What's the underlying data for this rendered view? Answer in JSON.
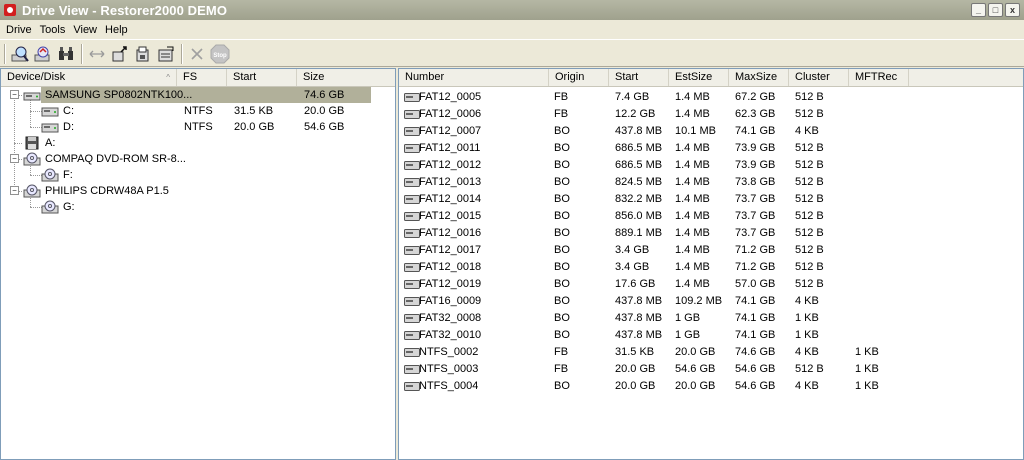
{
  "window": {
    "title": "Drive View - Restorer2000 DEMO",
    "controls": [
      "_",
      "□",
      "x"
    ]
  },
  "menu": [
    "Drive",
    "Tools",
    "View",
    "Help"
  ],
  "toolbar": {
    "buttons": [
      "search-disk-icon",
      "scan-disk-icon",
      "find-files-icon",
      "link-icon",
      "open-region-icon",
      "save-region-icon",
      "export-region-icon",
      "delete-icon",
      "stop-icon"
    ],
    "stop_label": "Stop"
  },
  "left": {
    "columns": [
      "Device/Disk",
      "FS",
      "Start",
      "Size"
    ],
    "tree": [
      {
        "label": "SAMSUNG SP0802NTK100...",
        "fs": "",
        "start": "",
        "size": "74.6 GB",
        "level": 0,
        "selected": true
      },
      {
        "label": "C:",
        "fs": "NTFS",
        "start": "31.5 KB",
        "size": "20.0 GB",
        "level": 1
      },
      {
        "label": "D:",
        "fs": "NTFS",
        "start": "20.0 GB",
        "size": "54.6 GB",
        "level": 1
      },
      {
        "label": "A:",
        "fs": "",
        "start": "",
        "size": "",
        "level": 0
      },
      {
        "label": "COMPAQ DVD-ROM SR-8...",
        "fs": "",
        "start": "",
        "size": "",
        "level": 0
      },
      {
        "label": "F:",
        "fs": "",
        "start": "",
        "size": "",
        "level": 1
      },
      {
        "label": "PHILIPS CDRW48A P1.5",
        "fs": "",
        "start": "",
        "size": "",
        "level": 0
      },
      {
        "label": "G:",
        "fs": "",
        "start": "",
        "size": "",
        "level": 1
      }
    ]
  },
  "right": {
    "columns": [
      "Number",
      "Origin",
      "Start",
      "EstSize",
      "MaxSize",
      "Cluster",
      "MFTRec"
    ],
    "rows": [
      [
        "FAT12_0005",
        "FB",
        "7.4 GB",
        "1.4 MB",
        "67.2 GB",
        "512 B",
        ""
      ],
      [
        "FAT12_0006",
        "FB",
        "12.2 GB",
        "1.4 MB",
        "62.3 GB",
        "512 B",
        ""
      ],
      [
        "FAT12_0007",
        "BO",
        "437.8 MB",
        "10.1 MB",
        "74.1 GB",
        "4 KB",
        ""
      ],
      [
        "FAT12_0011",
        "BO",
        "686.5 MB",
        "1.4 MB",
        "73.9 GB",
        "512 B",
        ""
      ],
      [
        "FAT12_0012",
        "BO",
        "686.5 MB",
        "1.4 MB",
        "73.9 GB",
        "512 B",
        ""
      ],
      [
        "FAT12_0013",
        "BO",
        "824.5 MB",
        "1.4 MB",
        "73.8 GB",
        "512 B",
        ""
      ],
      [
        "FAT12_0014",
        "BO",
        "832.2 MB",
        "1.4 MB",
        "73.7 GB",
        "512 B",
        ""
      ],
      [
        "FAT12_0015",
        "BO",
        "856.0 MB",
        "1.4 MB",
        "73.7 GB",
        "512 B",
        ""
      ],
      [
        "FAT12_0016",
        "BO",
        "889.1 MB",
        "1.4 MB",
        "73.7 GB",
        "512 B",
        ""
      ],
      [
        "FAT12_0017",
        "BO",
        "3.4 GB",
        "1.4 MB",
        "71.2 GB",
        "512 B",
        ""
      ],
      [
        "FAT12_0018",
        "BO",
        "3.4 GB",
        "1.4 MB",
        "71.2 GB",
        "512 B",
        ""
      ],
      [
        "FAT12_0019",
        "BO",
        "17.6 GB",
        "1.4 MB",
        "57.0 GB",
        "512 B",
        ""
      ],
      [
        "FAT16_0009",
        "BO",
        "437.8 MB",
        "109.2 MB",
        "74.1 GB",
        "4 KB",
        ""
      ],
      [
        "FAT32_0008",
        "BO",
        "437.8 MB",
        "1 GB",
        "74.1 GB",
        "1 KB",
        ""
      ],
      [
        "FAT32_0010",
        "BO",
        "437.8 MB",
        "1 GB",
        "74.1 GB",
        "1 KB",
        ""
      ],
      [
        "NTFS_0002",
        "FB",
        "31.5 KB",
        "20.0 GB",
        "74.6 GB",
        "4 KB",
        "1 KB"
      ],
      [
        "NTFS_0003",
        "FB",
        "20.0 GB",
        "54.6 GB",
        "54.6 GB",
        "512 B",
        "1 KB"
      ],
      [
        "NTFS_0004",
        "BO",
        "20.0 GB",
        "20.0 GB",
        "54.6 GB",
        "4 KB",
        "1 KB"
      ]
    ]
  },
  "colors": {
    "titlebar": "#a8aa96",
    "selection": "#b1b09a"
  }
}
